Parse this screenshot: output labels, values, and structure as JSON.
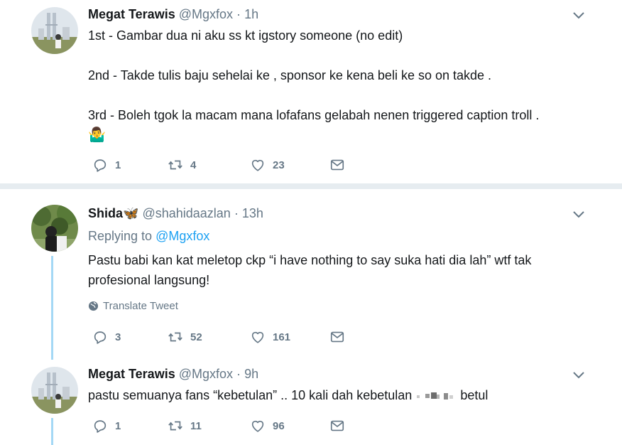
{
  "tweets": [
    {
      "name": "Megat Terawis",
      "handle": "@Mgxfox",
      "sep": "·",
      "time": "1h",
      "lines": [
        "1st - Gambar dua ni aku ss kt igstory someone (no edit)",
        "2nd - Takde tulis baju sehelai ke , sponsor ke kena beli ke so on takde .",
        "3rd - Boleh tgok la macam mana lofafans gelabah nenen triggered caption troll ."
      ],
      "emoji": "🤷‍♂️",
      "replies": "1",
      "retweets": "4",
      "likes": "23"
    },
    {
      "name": "Shida",
      "name_emoji": "🦋",
      "handle": "@shahidaazlan",
      "sep": "·",
      "time": "13h",
      "replying_prefix": "Replying to",
      "replying_handle": "@Mgxfox",
      "lines": [
        "Pastu babi kan kat meletop ckp “i have nothing to say suka hati dia lah” wtf tak",
        "profesional langsung!"
      ],
      "translate": "Translate Tweet",
      "replies": "3",
      "retweets": "52",
      "likes": "161"
    },
    {
      "name": "Megat Terawis",
      "handle": "@Mgxfox",
      "sep": "·",
      "time": "9h",
      "text_before": "pastu semuanya fans “kebetulan” .. 10 kali dah kebetulan",
      "text_after": "betul",
      "replies": "1",
      "retweets": "11",
      "likes": "96"
    }
  ],
  "icons": {
    "reply": "reply-icon",
    "retweet": "retweet-icon",
    "like": "heart-icon",
    "dm": "envelope-icon",
    "caret": "chevron-down-icon",
    "globe": "globe-icon"
  },
  "colors": {
    "text": "#14171a",
    "muted": "#657786",
    "link": "#1da1f2",
    "thread": "#a4d8f5",
    "divider": "#e6ecf0"
  }
}
